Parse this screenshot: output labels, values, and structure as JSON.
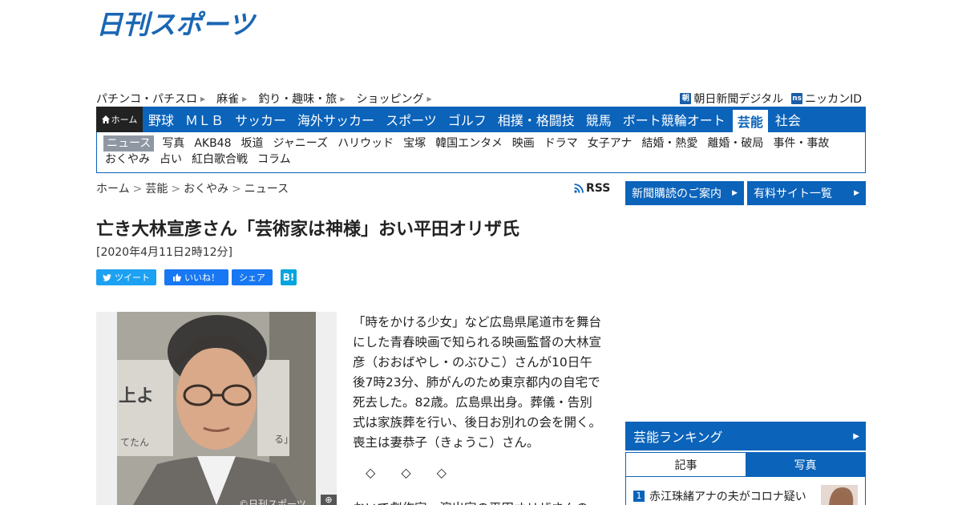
{
  "site": {
    "logo_text": "日刊スポーツ"
  },
  "top_links": [
    "パチンコ・パチスロ",
    "麻雀",
    "釣り・趣味・旅",
    "ショッピング"
  ],
  "partners": [
    {
      "badge": "朝",
      "label": "朝日新聞デジタル"
    },
    {
      "badge": "ns",
      "label": "ニッカンID"
    }
  ],
  "main_nav": {
    "home_label": "ホーム",
    "items": [
      "野球",
      "ＭＬＢ",
      "サッカー",
      "海外サッカー",
      "スポーツ",
      "ゴルフ",
      "相撲・格闘技",
      "競馬",
      "ボート競輪オート",
      "芸能",
      "社会"
    ],
    "active": "芸能"
  },
  "sub_nav": {
    "row1": [
      "ニュース",
      "写真",
      "AKB48",
      "坂道",
      "ジャニーズ",
      "ハリウッド",
      "宝塚",
      "韓国エンタメ",
      "映画",
      "ドラマ",
      "女子アナ",
      "結婚・熱愛",
      "離婚・破局",
      "事件・事故"
    ],
    "row2": [
      "おくやみ",
      "占い",
      "紅白歌合戦",
      "コラム"
    ],
    "active": "ニュース"
  },
  "breadcrumb": [
    "ホーム",
    "芸能",
    "おくやみ",
    "ニュース"
  ],
  "rss_label": "RSS",
  "side_buttons": [
    "新聞購読のご案内",
    "有料サイト一覧"
  ],
  "article": {
    "headline": "亡き大林宣彦さん「芸術家は神様」おい平田オリザ氏",
    "datetime": "[2020年4月11日2時12分]",
    "social": {
      "tweet": "ツイート",
      "like": "いいね！",
      "share": "シェア",
      "hatena": "B!"
    },
    "photo_credit": "©日刊スポーツ",
    "body_lines": [
      "「時をかける少女」など広島県尾道市を舞台",
      "にした青春映画で知られる映画監督の大林宣",
      "彦（おおばやし・のぶひこ）さんが10日午",
      "後7時23分、肺がんのため東京都内の自宅で",
      "死去した。82歳。広島県出身。葬儀・告別",
      "式は家族葬を行い、後日お別れの会を開く。",
      "喪主は妻恭子（きょうこ）さん。"
    ],
    "diamonds": [
      "◇",
      "◇",
      "◇"
    ],
    "cut_line": "おいで劇作家、演出家の平田オリザさんの"
  },
  "ranking": {
    "title": "芸能ランキング",
    "tabs": [
      "記事",
      "写真"
    ],
    "items": [
      {
        "rank": "1",
        "title": "赤江珠緒アナの夫がコロナ疑い"
      }
    ]
  },
  "colors": {
    "brand_blue": "#0b63ba",
    "home_dark": "#222222"
  }
}
